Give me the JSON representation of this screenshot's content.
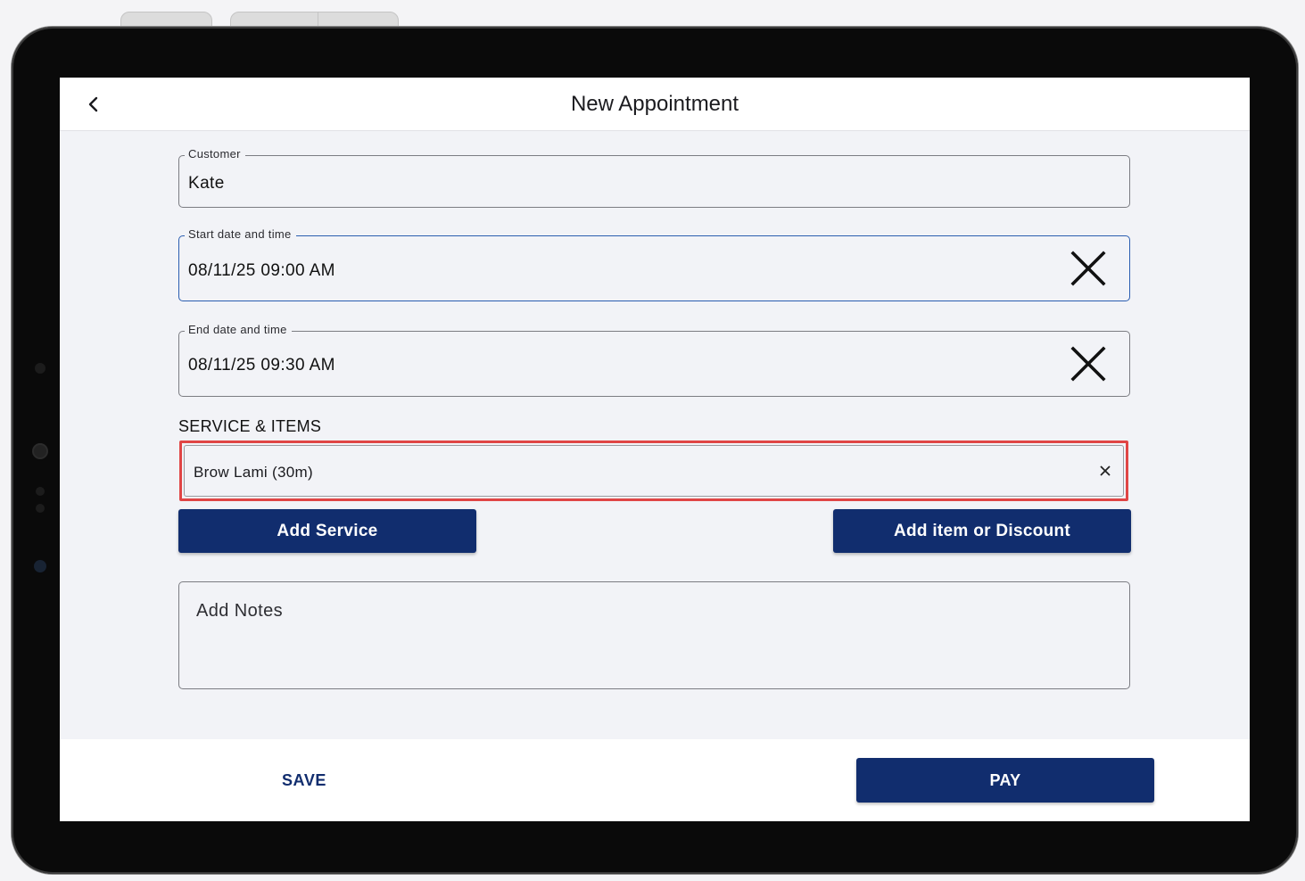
{
  "app": {
    "title": "New Appointment"
  },
  "form": {
    "customer": {
      "label": "Customer",
      "value": "Kate"
    },
    "start": {
      "label": "Start date and time",
      "value": "08/11/25 09:00 AM"
    },
    "end": {
      "label": "End date and time",
      "value": "08/11/25 09:30 AM"
    }
  },
  "services": {
    "section_title": "SERVICE & ITEMS",
    "items": [
      {
        "label": "Brow Lami (30m)"
      }
    ],
    "add_service_label": "Add Service",
    "add_item_label": "Add item or Discount"
  },
  "notes": {
    "placeholder": "Add Notes"
  },
  "footer": {
    "save_label": "SAVE",
    "pay_label": "PAY"
  },
  "colors": {
    "primary": "#112d6e",
    "focus_border": "#2a5db0",
    "highlight": "#e04545",
    "screen_bg": "#f2f3f7"
  },
  "icons": {
    "back": "chevron-left-icon",
    "clear": "close-icon",
    "remove": "close-icon"
  }
}
